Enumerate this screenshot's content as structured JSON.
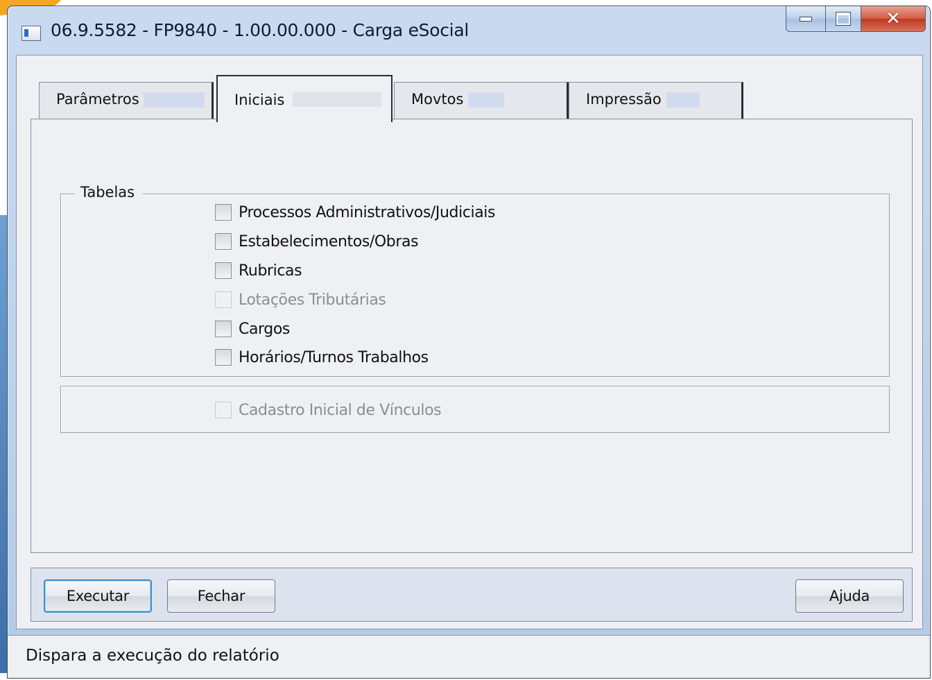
{
  "window": {
    "title": "06.9.5582 - FP9840 - 1.00.00.000 - Carga eSocial"
  },
  "tabs": [
    {
      "label": "Parâmetros",
      "active": false
    },
    {
      "label": "Iniciais",
      "active": true
    },
    {
      "label": "Movtos",
      "active": false
    },
    {
      "label": "Impressão",
      "active": false
    }
  ],
  "tabelas_group": {
    "title": "Tabelas",
    "options": [
      {
        "label": "Processos Administrativos/Judiciais",
        "checked": false,
        "enabled": true
      },
      {
        "label": "Estabelecimentos/Obras",
        "checked": false,
        "enabled": true
      },
      {
        "label": "Rubricas",
        "checked": false,
        "enabled": true
      },
      {
        "label": "Lotações Tributárias",
        "checked": false,
        "enabled": false
      },
      {
        "label": "Cargos",
        "checked": false,
        "enabled": true
      },
      {
        "label": "Horários/Turnos Trabalhos",
        "checked": false,
        "enabled": true
      }
    ]
  },
  "vinculos_group": {
    "option": {
      "label": "Cadastro Inicial de Vínculos",
      "checked": false,
      "enabled": false
    }
  },
  "buttons": {
    "execute": "Executar",
    "close": "Fechar",
    "help": "Ajuda"
  },
  "status_bar": {
    "text": "Dispara a execução do relatório"
  }
}
